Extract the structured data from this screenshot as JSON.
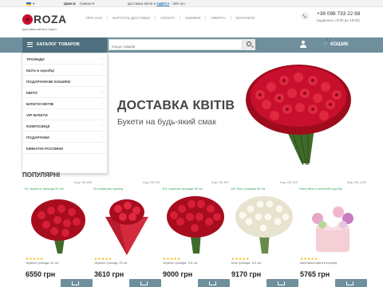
{
  "topbar": {
    "flag_icon": "ukraine-flag-icon",
    "prices_label": "Ціни в:",
    "currency": "Гривня",
    "delivery_prefix": "Доставка квітів в",
    "city": "ОДЕСА",
    "delivery_suffix": "- 300 грн"
  },
  "header": {
    "logo_text": "ROZA",
    "tagline": "Доставка квітів в Одесі",
    "nav": [
      "ПРО НАС",
      "ВАРТІСТЬ ДОСТАВКИ",
      "ОПЛАТА",
      "ЗНИЖКИ",
      "ОФЕРТА",
      "КОНТАКТИ"
    ],
    "phone": "+38 098 733 22 88",
    "hours": "(щоденно з 9:00 до 18:00)"
  },
  "catbar": {
    "catalog_label": "КАТАЛОГ ТОВАРОВ",
    "search_placeholder": "пошук товарів",
    "cart_label": "КОШИК",
    "cart_count": "0",
    "colors": {
      "bar": "#6f8f9d",
      "button": "#4e6f7d"
    }
  },
  "menu": {
    "items": [
      {
        "label": "ТРОЯНДИ",
        "has_sub": true
      },
      {
        "label": "Квіти в коробці",
        "has_sub": true
      },
      {
        "label": "ПОДАРУНКОВІ КОШИКИ",
        "has_sub": false
      },
      {
        "label": "КВІТИ",
        "has_sub": true
      },
      {
        "label": "БУКЕТИ КВІТІВ",
        "has_sub": true
      },
      {
        "label": "VIP БУКЕТИ",
        "has_sub": false
      },
      {
        "label": "КОМПОЗИЦІЇ",
        "has_sub": true
      },
      {
        "label": "ПОДАРУНКИ",
        "has_sub": true
      },
      {
        "label": "КІМНАТНІ РОСЛИНИ",
        "has_sub": false
      }
    ]
  },
  "hero": {
    "title": "ДОСТАВКА КВІТІВ",
    "subtitle": "Букети на будь-який смак"
  },
  "popular": {
    "heading": "ПОПУЛЯРНІ",
    "products": [
      {
        "code": "Код: OD-606",
        "name": "51 червона троянда 50 см",
        "desc": "Червоні троянди: 51 шт.",
        "price": "6550 грн",
        "rating": 5,
        "kind": "red-bouquet"
      },
      {
        "code": "Код: OD-267",
        "name": "25 червоних троянд",
        "desc": "Червоні троянди: 25 шт.",
        "price": "3610 грн",
        "rating": 5,
        "kind": "red-wrapped"
      },
      {
        "code": "Код: OD-607",
        "name": "101 червона троянда 50 см",
        "desc": "Червоні троянди: 101 шт.",
        "price": "9000 грн",
        "rating": 5,
        "kind": "red-big"
      },
      {
        "code": "Код: OD-410",
        "name": "101 біла троянда 60 см",
        "desc": "Біла троянда: 101 шт.",
        "price": "9170 грн",
        "rating": 5,
        "kind": "white-big"
      },
      {
        "code": "Код: OD-1200",
        "name": "Ніжні квіти в шляпній коробці",
        "desc": "Капелюшні квіти в коробці",
        "price": "5765 грн",
        "rating": 5,
        "kind": "pink-box"
      }
    ]
  }
}
